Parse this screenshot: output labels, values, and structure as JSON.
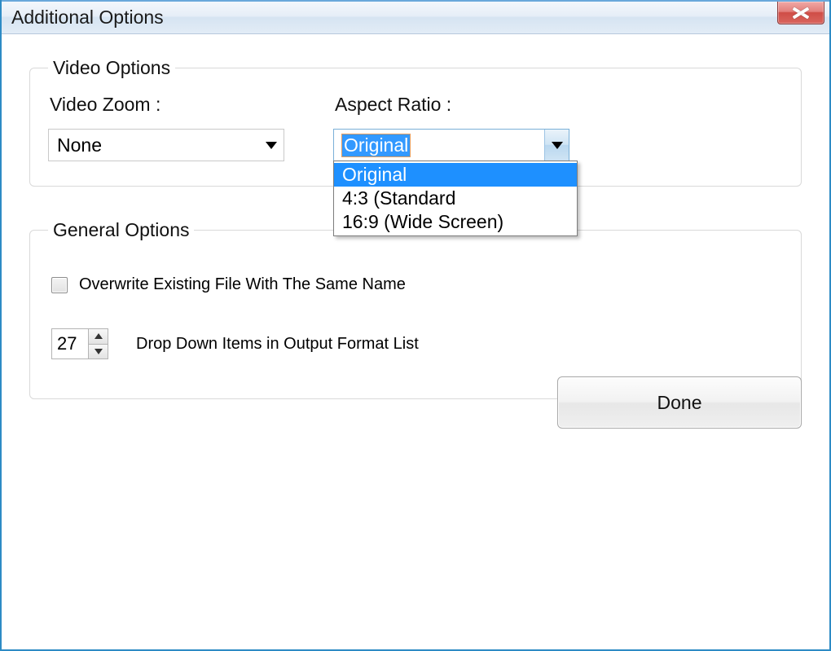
{
  "window": {
    "title": "Additional Options"
  },
  "video_options": {
    "legend": "Video Options",
    "zoom_label": "Video Zoom :",
    "zoom_value": "None",
    "aspect_label": "Aspect Ratio :",
    "aspect_value": "Original",
    "aspect_options": [
      "Original",
      "4:3 (Standard",
      "16:9 (Wide Screen)"
    ]
  },
  "general_options": {
    "legend": "General Options",
    "overwrite_label": "Overwrite Existing File With The Same Name",
    "overwrite_checked": false,
    "dropdown_count": "27",
    "dropdown_count_label": "Drop Down Items in Output Format List"
  },
  "buttons": {
    "done": "Done"
  }
}
